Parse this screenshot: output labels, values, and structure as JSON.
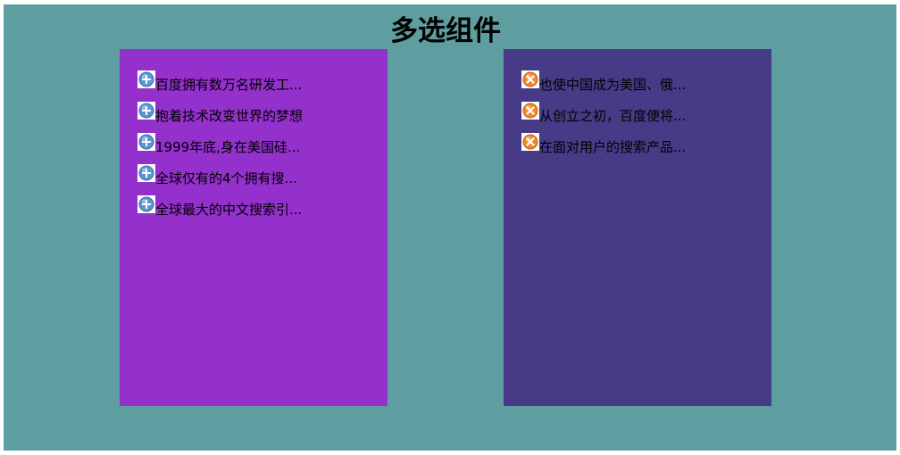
{
  "title": "多选组件",
  "colors": {
    "background": "#5f9ea0",
    "left_panel": "#9430cc",
    "right_panel": "#473a86",
    "add_icon": "#5b95d6",
    "remove_icon": "#ee8a2c"
  },
  "left_list": {
    "icon": "add-icon",
    "items": [
      {
        "label": "百度拥有数万名研发工..."
      },
      {
        "label": "抱着技术改变世界的梦想"
      },
      {
        "label": "1999年底,身在美国硅..."
      },
      {
        "label": "全球仅有的4个拥有搜..."
      },
      {
        "label": "全球最大的中文搜索引..."
      }
    ]
  },
  "right_list": {
    "icon": "remove-icon",
    "items": [
      {
        "label": "也使中国成为美国、俄..."
      },
      {
        "label": "从创立之初，百度便将..."
      },
      {
        "label": "在面对用户的搜索产品..."
      }
    ]
  }
}
